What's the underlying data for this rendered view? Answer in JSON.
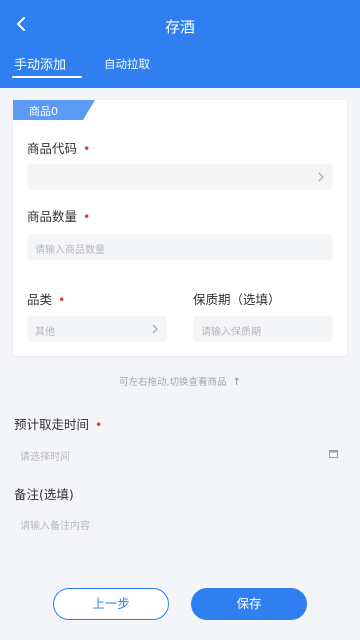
{
  "header": {
    "title": "存酒",
    "tabs": [
      {
        "label": "手动添加",
        "active": true
      },
      {
        "label": "自动拉取",
        "active": false
      }
    ]
  },
  "product_card": {
    "badge": "商品0",
    "code_label": "商品代码",
    "qty_label": "商品数量",
    "qty_placeholder": "请输入商品数量",
    "category_label": "品类",
    "category_value": "其他",
    "shelf_label": "保质期（选填）",
    "shelf_placeholder": "请输入保质期"
  },
  "swipe_hint": "可左右拖动,切换查看商品",
  "pickup": {
    "label": "预计取走时间",
    "placeholder": "请选择时间"
  },
  "remark": {
    "label": "备注(选填)",
    "placeholder": "请输入备注内容"
  },
  "buttons": {
    "prev": "上一步",
    "save": "保存"
  },
  "colors": {
    "primary": "#2f7ff0",
    "required": "#e23b3b",
    "background": "#f4f5f8"
  }
}
